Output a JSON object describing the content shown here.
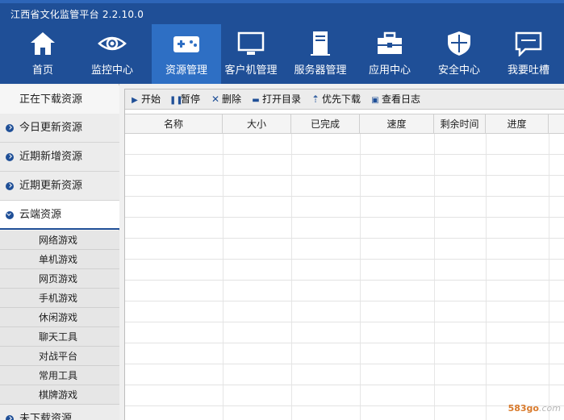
{
  "app": {
    "title": "江西省文化监管平台 2.2.10.0"
  },
  "nav": {
    "items": [
      {
        "label": "首页",
        "icon": "home-icon"
      },
      {
        "label": "监控中心",
        "icon": "eye-icon"
      },
      {
        "label": "资源管理",
        "icon": "gamepad-icon",
        "active": true
      },
      {
        "label": "客户机管理",
        "icon": "monitor-icon"
      },
      {
        "label": "服务器管理",
        "icon": "server-icon"
      },
      {
        "label": "应用中心",
        "icon": "toolbox-icon"
      },
      {
        "label": "安全中心",
        "icon": "shield-icon"
      },
      {
        "label": "我要吐槽",
        "icon": "chat-icon"
      }
    ]
  },
  "sidebar": {
    "items": [
      {
        "label": "正在下载资源"
      },
      {
        "label": "今日更新资源"
      },
      {
        "label": "近期新增资源"
      },
      {
        "label": "近期更新资源"
      },
      {
        "label": "云端资源"
      }
    ],
    "sub_items": [
      "网络游戏",
      "单机游戏",
      "网页游戏",
      "手机游戏",
      "休闲游戏",
      "聊天工具",
      "对战平台",
      "常用工具",
      "棋牌游戏"
    ],
    "bottom_item": {
      "label": "未下载资源"
    }
  },
  "toolbar": {
    "start": "开始",
    "pause": "暂停",
    "delete": "删除",
    "open_dir": "打开目录",
    "priority": "优先下载",
    "view_log": "查看日志"
  },
  "table": {
    "columns": [
      "名称",
      "大小",
      "已完成",
      "速度",
      "剩余时间",
      "进度"
    ]
  },
  "watermark": {
    "brand": "583go",
    "suffix": ".com"
  },
  "colors": {
    "header": "#1f4f97",
    "active_nav": "#2e6fc4"
  }
}
